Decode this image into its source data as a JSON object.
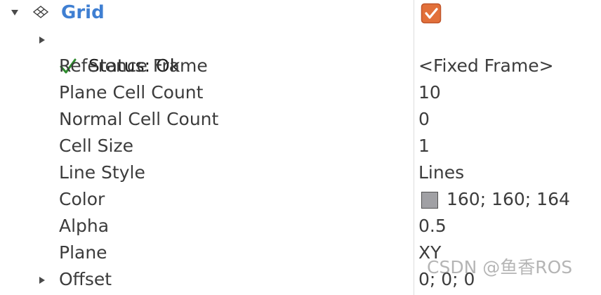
{
  "display": {
    "name": "Grid",
    "enabled_checked": true,
    "status": {
      "label": "Status: Ok"
    },
    "properties": [
      {
        "label": "Reference Frame",
        "value": "<Fixed Frame>"
      },
      {
        "label": "Plane Cell Count",
        "value": "10"
      },
      {
        "label": "Normal Cell Count",
        "value": "0"
      },
      {
        "label": "Cell Size",
        "value": "1"
      },
      {
        "label": "Line Style",
        "value": "Lines"
      },
      {
        "label": "Color",
        "value": "160; 160; 164",
        "swatch": "#a0a0a4"
      },
      {
        "label": "Alpha",
        "value": "0.5"
      },
      {
        "label": "Plane",
        "value": "XY"
      },
      {
        "label": "Offset",
        "value": "0; 0; 0"
      }
    ]
  },
  "colors": {
    "grid_label": "#3f7fd2",
    "check_green": "#2e8b2e",
    "checkbox_orange": "#e2703a",
    "divider": "#dcdcdc"
  },
  "icons": {
    "expand_grid": "chevron-down-icon",
    "display_type": "grid-display-icon",
    "status_ok": "check-icon",
    "expand_status": "chevron-right-icon",
    "expand_offset": "chevron-right-icon"
  },
  "watermark": "CSDN @鱼香ROS"
}
